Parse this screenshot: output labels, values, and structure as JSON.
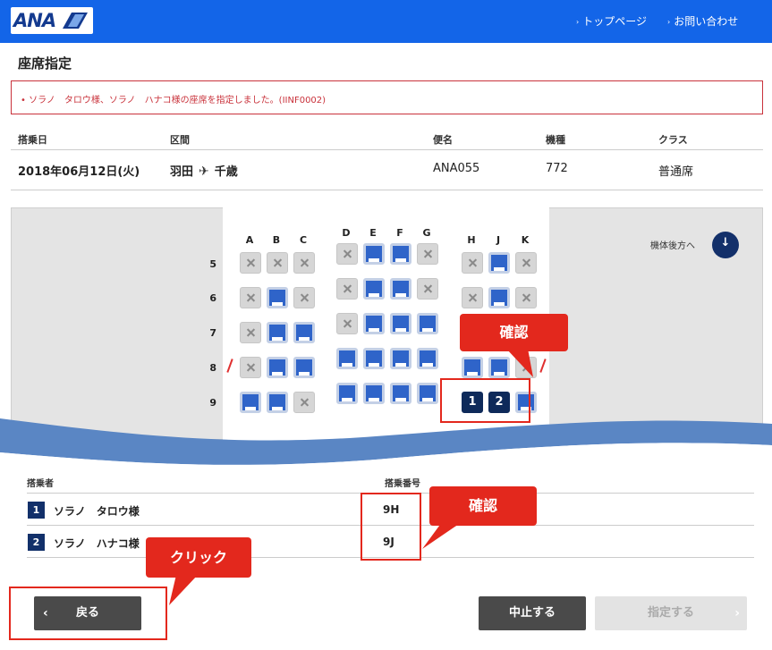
{
  "header": {
    "logo_text": "ANA",
    "nav": [
      "トップページ",
      "お問い合わせ"
    ]
  },
  "page": {
    "title": "座席指定",
    "message": "• ソラノ　タロウ様、ソラノ　ハナコ様の座席を指定しました。(IINF0002)"
  },
  "flight": {
    "headers": {
      "date": "搭乗日",
      "route": "区間",
      "flight": "便名",
      "aircraft": "機種",
      "class": "クラス"
    },
    "date": "2018年06月12日(火)",
    "origin": "羽田",
    "destination": "千歳",
    "flight_no": "ANA055",
    "aircraft": "772",
    "class": "普通席"
  },
  "seatmap": {
    "columns": [
      "A",
      "B",
      "C",
      "D",
      "E",
      "F",
      "G",
      "H",
      "J",
      "K"
    ],
    "rows": [
      "5",
      "6",
      "7",
      "8",
      "9"
    ],
    "back_link": "機体後方へ",
    "seats": {
      "5": [
        "na",
        "na",
        "na",
        "na",
        "av",
        "av",
        "na",
        "na",
        "av",
        "na"
      ],
      "6": [
        "na",
        "av",
        "na",
        "na",
        "av",
        "av",
        "na",
        "na",
        "av",
        "na"
      ],
      "7": [
        "na",
        "av",
        "av",
        "na",
        "av",
        "av",
        "av",
        "",
        "",
        ""
      ],
      "8": [
        "na",
        "av",
        "av",
        "av",
        "av",
        "av",
        "av",
        "av",
        "av",
        "na"
      ],
      "9": [
        "av",
        "av",
        "na",
        "av",
        "av",
        "av",
        "av",
        "sel1",
        "sel2",
        "av"
      ]
    },
    "selected_labels": {
      "sel1": "1",
      "sel2": "2"
    }
  },
  "passengers": {
    "headers": {
      "name": "搭乗者",
      "seat": "搭乗番号"
    },
    "list": [
      {
        "num": "1",
        "name": "ソラノ　タロウ様",
        "seat": "9H"
      },
      {
        "num": "2",
        "name": "ソラノ　ハナコ様",
        "seat": "9J"
      }
    ]
  },
  "callouts": {
    "confirm1": "確認",
    "confirm2": "確認",
    "click": "クリック"
  },
  "buttons": {
    "back": "戻る",
    "cancel": "中止する",
    "assign": "指定する"
  },
  "colors": {
    "header_blue": "#1365e8",
    "navy": "#12306a",
    "seat_available": "#2f64c9",
    "callout_red": "#e3281d"
  }
}
